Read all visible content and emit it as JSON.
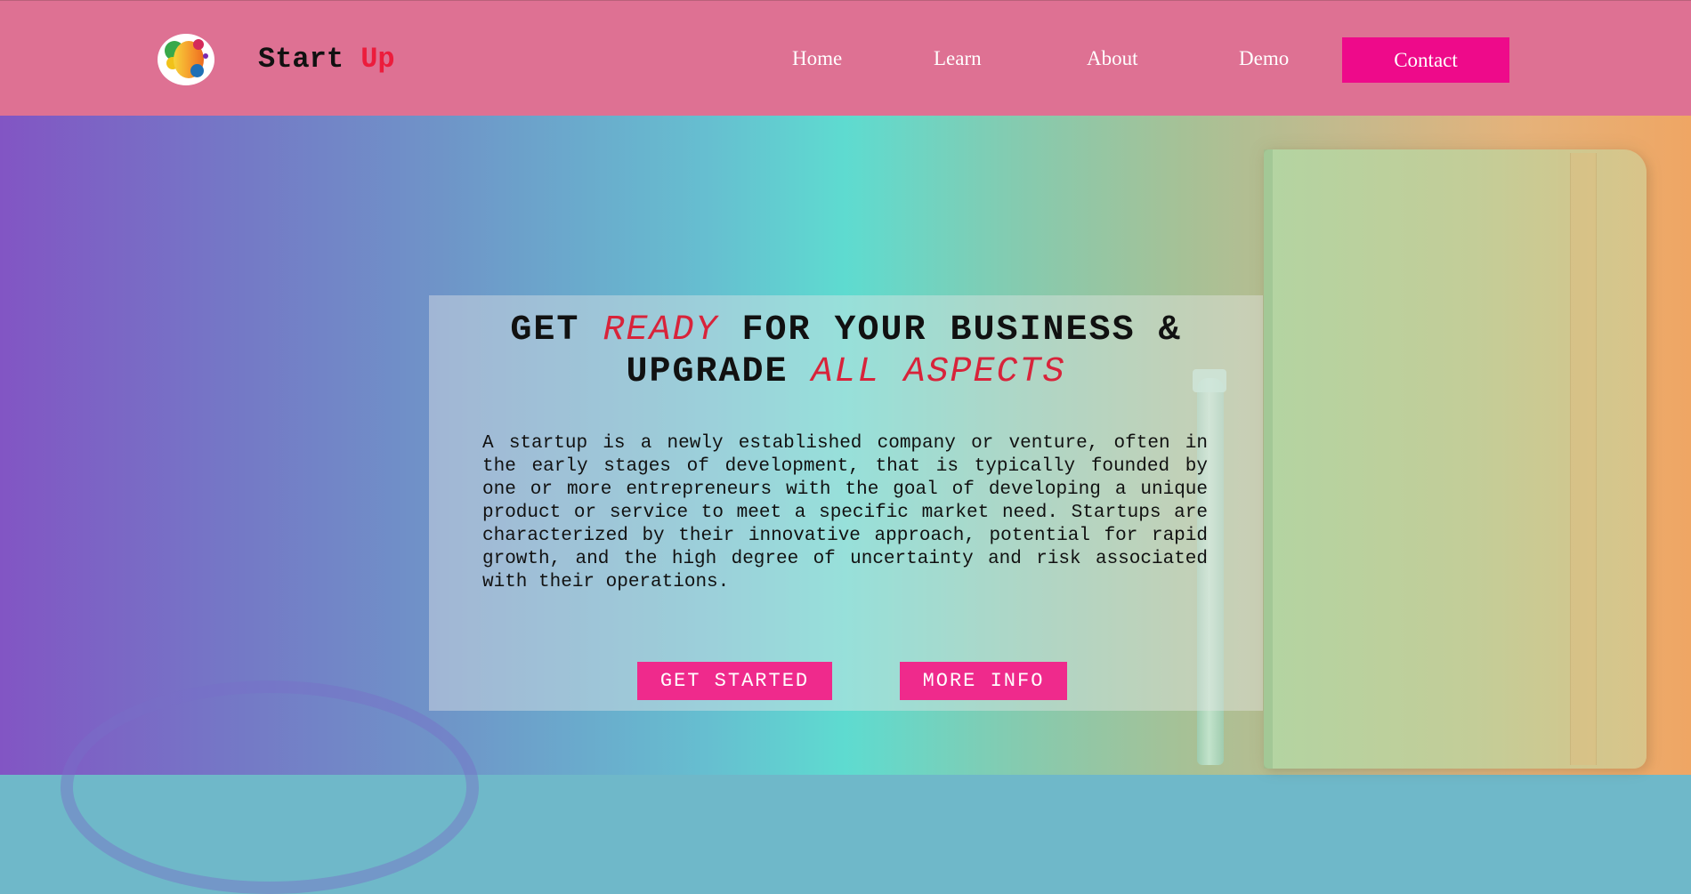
{
  "header": {
    "brand_part1": "Start",
    "brand_part2": "Up",
    "nav": {
      "home": "Home",
      "learn": "Learn",
      "about": "About",
      "demo": "Demo",
      "contact": "Contact"
    }
  },
  "hero": {
    "title": {
      "w1": "GET",
      "w2": "READY",
      "w3": "FOR YOUR BUSINESS &",
      "w4": "UPGRADE",
      "w5": "ALL ASPECTS"
    },
    "description": "A startup is a newly established company or venture, often in the early stages of development, that is typically founded by one or more entrepreneurs with the goal of developing a unique product or service to meet a specific market need. Startups are characterized by their innovative approach, potential for rapid growth, and the high degree of uncertainty and risk associated with their operations.",
    "buttons": {
      "get_started": "GET STARTED",
      "more_info": "MORE INFO"
    }
  },
  "colors": {
    "navbar": "#de7193",
    "brand_accent": "#ec1c3c",
    "contact_button": "#ee0a8a",
    "hero_button": "#ef2a8c",
    "title_accent": "#d8233a"
  },
  "icons": {
    "logo": "colorful-circles-logo-icon"
  }
}
